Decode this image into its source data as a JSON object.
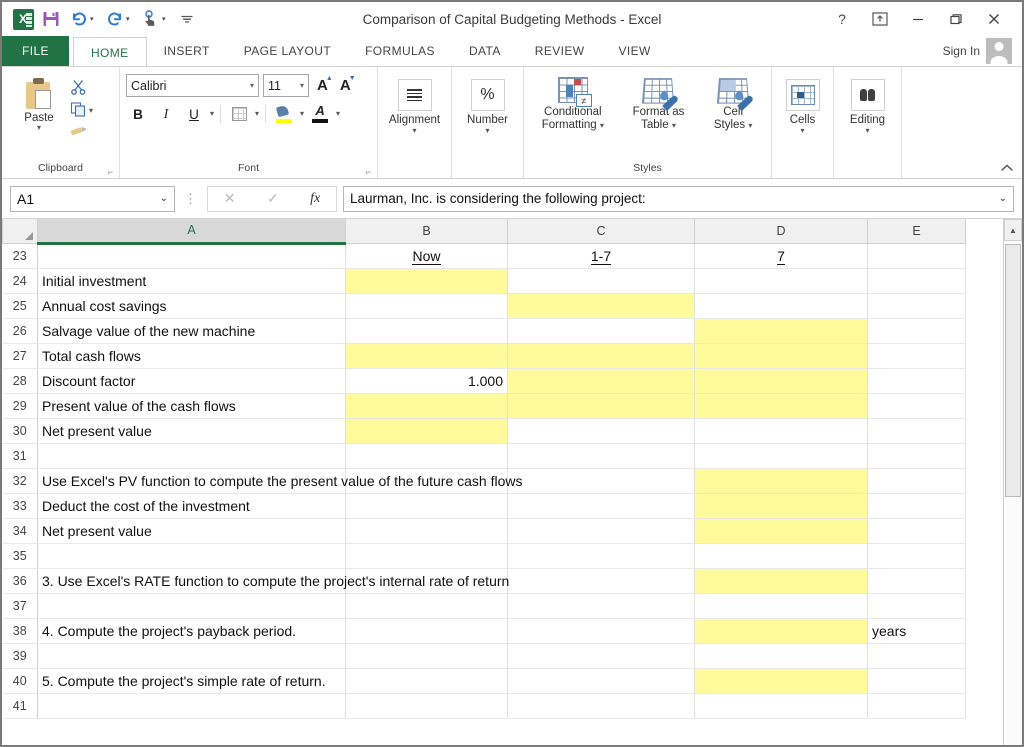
{
  "window": {
    "title": "Comparison of Capital Budgeting Methods - Excel",
    "help_icon": "?",
    "ribbon_display_icon": "ribbon-display-options-icon",
    "minimize_icon": "—",
    "restore_icon": "restore-icon",
    "close_icon": "✕"
  },
  "quick_access": {
    "app_logo": "excel-logo",
    "save": "save-icon",
    "undo": "undo-icon",
    "redo": "redo-icon",
    "touch_mode": "touch-mouse-mode-icon",
    "customize": "customize-quick-access-toolbar-icon"
  },
  "tabs": {
    "file": "FILE",
    "items": [
      "HOME",
      "INSERT",
      "PAGE LAYOUT",
      "FORMULAS",
      "DATA",
      "REVIEW",
      "VIEW"
    ],
    "active": "HOME",
    "sign_in": "Sign In"
  },
  "ribbon": {
    "clipboard": {
      "label": "Clipboard",
      "paste": "Paste",
      "cut": "cut-icon",
      "copy": "copy-icon",
      "format_painter": "format-painter-icon",
      "dialog_launcher": "⌐"
    },
    "font": {
      "label": "Font",
      "font_name": "Calibri",
      "font_size": "11",
      "grow_font": "A",
      "shrink_font": "A",
      "bold": "B",
      "italic": "I",
      "underline": "U",
      "borders": "borders-icon",
      "fill_color": "fill-color-icon",
      "font_color": "A",
      "dialog_launcher": "⌐"
    },
    "alignment": {
      "label": "Alignment"
    },
    "number": {
      "label": "Number",
      "symbol": "%"
    },
    "styles": {
      "label": "Styles",
      "conditional_formatting": "Conditional\nFormatting",
      "conditional_formatting_l1": "Conditional",
      "conditional_formatting_l2": "Formatting",
      "format_as_table_l1": "Format as",
      "format_as_table_l2": "Table",
      "cell_styles_l1": "Cell",
      "cell_styles_l2": "Styles"
    },
    "cells": {
      "label": "Cells"
    },
    "editing": {
      "label": "Editing"
    },
    "collapse": "collapse-ribbon-icon"
  },
  "formula_bar": {
    "name_box": "A1",
    "cancel_icon": "✕",
    "enter_icon": "✓",
    "function_icon": "fx",
    "content": "Laurman, Inc. is considering the following project:"
  },
  "grid": {
    "columns": [
      "A",
      "B",
      "C",
      "D",
      "E"
    ],
    "selected_column": "A",
    "rows": [
      {
        "n": "23",
        "a": "",
        "b": "Now",
        "c": "1-7",
        "d": "7",
        "e": "",
        "style": {
          "header": true
        }
      },
      {
        "n": "24",
        "a": "Initial investment",
        "b": "",
        "c": "",
        "d": "",
        "e": "",
        "fill": [
          "b"
        ]
      },
      {
        "n": "25",
        "a": "Annual cost savings",
        "b": "",
        "c": "",
        "d": "",
        "e": "",
        "fill": [
          "c"
        ]
      },
      {
        "n": "26",
        "a": "Salvage value of the new machine",
        "b": "",
        "c": "",
        "d": "",
        "e": "",
        "fill": [
          "d"
        ]
      },
      {
        "n": "27",
        "a": "Total cash flows",
        "b": "",
        "c": "",
        "d": "",
        "e": "",
        "fill": [
          "b",
          "c",
          "d"
        ],
        "topborder": [
          "b",
          "c",
          "d"
        ]
      },
      {
        "n": "28",
        "a": "Discount factor",
        "b": "1.000",
        "c": "",
        "d": "",
        "e": "",
        "fill": [
          "c",
          "d"
        ],
        "numeric": [
          "b"
        ]
      },
      {
        "n": "29",
        "a": "Present value of the cash flows",
        "b": "",
        "c": "",
        "d": "",
        "e": "",
        "fill": [
          "b",
          "c",
          "d"
        ],
        "topborder": [
          "b",
          "c",
          "d"
        ]
      },
      {
        "n": "30",
        "a": "Net present value",
        "b": "",
        "c": "",
        "d": "",
        "e": "",
        "fill": [
          "b"
        ]
      },
      {
        "n": "31",
        "a": "",
        "b": "",
        "c": "",
        "d": "",
        "e": ""
      },
      {
        "n": "32",
        "a": "Use Excel's PV function to compute the present value of the future cash flows",
        "b": "",
        "c": "",
        "d": "",
        "e": "",
        "fill": [
          "d"
        ],
        "overflow": true
      },
      {
        "n": "33",
        "a": "Deduct the cost of the investment",
        "b": "",
        "c": "",
        "d": "",
        "e": "",
        "fill": [
          "d"
        ]
      },
      {
        "n": "34",
        "a": "Net present value",
        "b": "",
        "c": "",
        "d": "",
        "e": "",
        "fill": [
          "d"
        ]
      },
      {
        "n": "35",
        "a": "",
        "b": "",
        "c": "",
        "d": "",
        "e": ""
      },
      {
        "n": "36",
        "a": "3. Use Excel's RATE function to compute the project's internal rate of return",
        "b": "",
        "c": "",
        "d": "",
        "e": "",
        "fill": [
          "d"
        ],
        "overflow": true
      },
      {
        "n": "37",
        "a": "",
        "b": "",
        "c": "",
        "d": "",
        "e": ""
      },
      {
        "n": "38",
        "a": "4. Compute the project's payback period.",
        "b": "",
        "c": "",
        "d": "",
        "e": "years",
        "fill": [
          "d"
        ],
        "overflow": true
      },
      {
        "n": "39",
        "a": "",
        "b": "",
        "c": "",
        "d": "",
        "e": ""
      },
      {
        "n": "40",
        "a": "5. Compute the project's simple rate of return.",
        "b": "",
        "c": "",
        "d": "",
        "e": "",
        "fill": [
          "d"
        ],
        "overflow": true
      },
      {
        "n": "41",
        "a": "",
        "b": "",
        "c": "",
        "d": "",
        "e": ""
      }
    ]
  },
  "scrollbar": {
    "up_arrow": "▲"
  },
  "colors": {
    "excel_green": "#217346",
    "highlight_yellow": "#fffb9d",
    "selected_header": "#d8d8d8"
  }
}
